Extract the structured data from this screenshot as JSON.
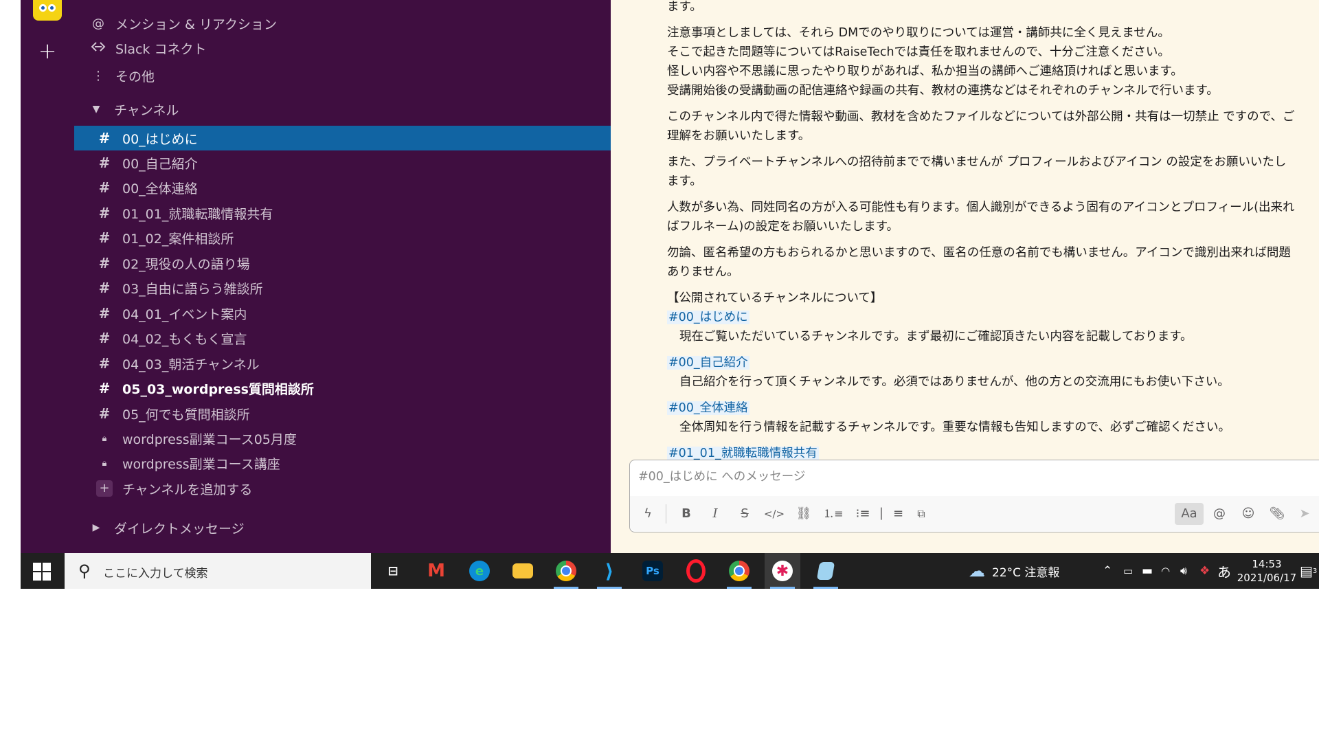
{
  "workspace": {
    "avatar_icon": "spongebob-avatar-icon",
    "add_icon": "plus-icon"
  },
  "sidebar": {
    "nav": [
      {
        "label": "メンション & リアクション",
        "icon": "at-icon"
      },
      {
        "label": "Slack コネクト",
        "icon": "slack-connect-icon"
      },
      {
        "label": "その他",
        "icon": "more-vertical-icon"
      }
    ],
    "channels_header": "チャンネル",
    "channels": [
      {
        "name": "00_はじめに",
        "kind": "public",
        "state": "active"
      },
      {
        "name": "00_自己紹介",
        "kind": "public",
        "state": "normal"
      },
      {
        "name": "00_全体連絡",
        "kind": "public",
        "state": "normal"
      },
      {
        "name": "01_01_就職転職情報共有",
        "kind": "public",
        "state": "normal"
      },
      {
        "name": "01_02_案件相談所",
        "kind": "public",
        "state": "normal"
      },
      {
        "name": "02_現役の人の語り場",
        "kind": "public",
        "state": "normal"
      },
      {
        "name": "03_自由に語らう雑談所",
        "kind": "public",
        "state": "normal"
      },
      {
        "name": "04_01_イベント案内",
        "kind": "public",
        "state": "normal"
      },
      {
        "name": "04_02_もくもく宣言",
        "kind": "public",
        "state": "normal"
      },
      {
        "name": "04_03_朝活チャンネル",
        "kind": "public",
        "state": "normal"
      },
      {
        "name": "05_03_wordpress質問相談所",
        "kind": "public",
        "state": "unread"
      },
      {
        "name": "05_何でも質問相談所",
        "kind": "public",
        "state": "normal"
      },
      {
        "name": "wordpress副業コース05月度",
        "kind": "private",
        "state": "normal"
      },
      {
        "name": "wordpress副業コース講座",
        "kind": "private",
        "state": "normal"
      }
    ],
    "add_channel": "チャンネルを追加する",
    "dm_header": "ダイレクトメッセージ"
  },
  "message": {
    "lines": [
      "ます。",
      "注意事項としましては、それら DMでのやり取りについては運営・講師共に全く見えません。",
      "そこで起きた問題等についてはRaiseTechでは責任を取れませんので、十分ご注意ください。",
      "怪しい内容や不思議に思ったやり取りがあれば、私か担当の講師へご連絡頂ければと思います。",
      "受講開始後の受講動画の配信連絡や録画の共有、教材の連携などはそれぞれのチャンネルで行います。",
      "このチャンネル内で得た情報や動画、教材を含めたファイルなどについては外部公開・共有は一切禁止 ですので、ご",
      "理解をお願いいたします。",
      "また、プライベートチャンネルへの招待前までで構いませんが プロフィールおよびアイコン の設定をお願いいたし",
      "ます。",
      "人数が多い為、同姓同名の方が入る可能性も有ります。個人識別ができるよう固有のアイコンとプロフィール(出来れ",
      "ばフルネーム)の設定をお願いいたします。",
      "勿論、匿名希望の方もおられるかと思いますので、匿名の任意の名前でも構いません。アイコンで識別出来れば問題",
      "ありません。",
      "【公開されているチャンネルについて】"
    ],
    "channel_list": [
      {
        "link": "#00_はじめに",
        "desc": "現在ご覧いただいているチャンネルです。まず最初にご確認頂きたい内容を記載しております。"
      },
      {
        "link": "#00_自己紹介",
        "desc": "自己紹介を行って頂くチャンネルです。必須ではありませんが、他の方との交流用にもお使い下さい。"
      },
      {
        "link": "#00_全体連絡",
        "desc": "全体周知を行う情報を記載するチャンネルです。重要な情報も告知しますので、必ずご確認ください。"
      },
      {
        "link": "#01_01_就職転職情報共有",
        "desc": ""
      }
    ]
  },
  "composer": {
    "placeholder": "#00_はじめに へのメッセージ",
    "buttons": [
      "shortcuts-icon",
      "bold-icon",
      "italic-icon",
      "strikethrough-icon",
      "code-icon",
      "link-icon",
      "ordered-list-icon",
      "bulleted-list-icon",
      "blockquote-icon",
      "code-block-icon",
      "format-toggle-icon",
      "mention-icon",
      "emoji-icon",
      "attach-icon",
      "send-icon"
    ],
    "labels": {
      "bold": "B",
      "italic": "I",
      "strike": "S",
      "format": "Aa",
      "mention": "@"
    }
  },
  "taskbar": {
    "search_placeholder": "ここに入力して検索",
    "weather": "22°C 注意報",
    "ime": "あ",
    "time": "14:53",
    "date": "2021/06/17",
    "notification_count": "3",
    "apps": [
      "task-view-icon",
      "gmail-icon",
      "edge-icon",
      "file-explorer-icon",
      "chrome-icon",
      "vscode-icon",
      "photoshop-icon",
      "opera-icon",
      "chrome-icon",
      "slack-icon",
      "notepad-icon"
    ],
    "photoshop_label": "Ps"
  }
}
